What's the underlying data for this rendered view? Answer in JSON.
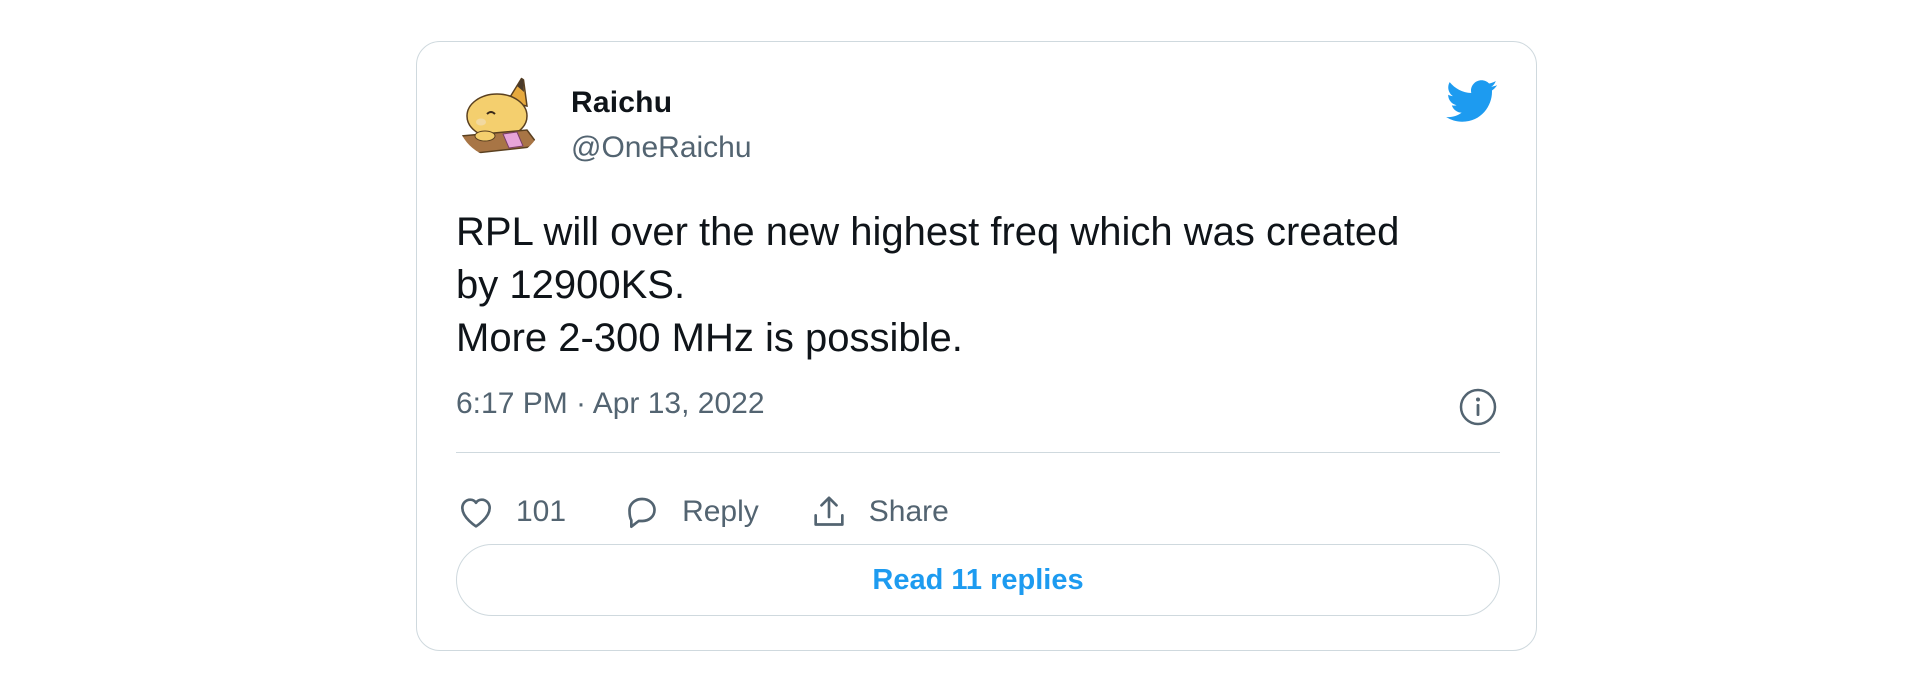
{
  "author": {
    "name": "Raichu",
    "handle": "@OneRaichu",
    "avatar_icon": "raichu-avatar"
  },
  "brand_icon": "twitter-bird-icon",
  "tweet": {
    "lines": [
      "RPL will over the new highest freq which was created",
      "by 12900KS.",
      "More 2-300 MHz is possible."
    ],
    "timestamp": "6:17 PM · Apr 13, 2022"
  },
  "actions": {
    "like_count": "101",
    "reply_label": "Reply",
    "share_label": "Share"
  },
  "read_replies_label": "Read 11 replies",
  "colors": {
    "brand_blue": "#1d9bf0",
    "text_primary": "#0f1419",
    "text_secondary": "#536471",
    "border": "#cfd9de"
  }
}
